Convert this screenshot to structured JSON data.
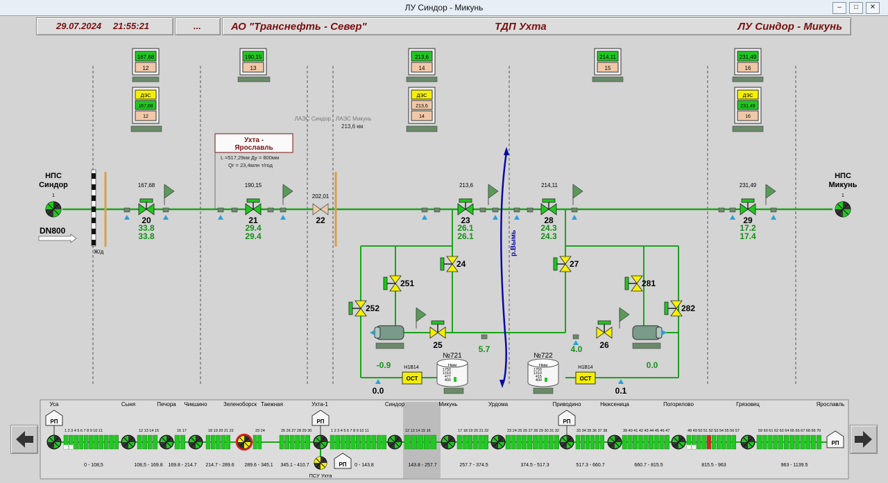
{
  "window": {
    "title": "ЛУ Синдор - Микунь",
    "min": "‒",
    "max": "□",
    "close": "✕"
  },
  "header": {
    "date": "29.07.2024",
    "time": "21:55:21",
    "dots": "...",
    "company": "АО \"Транснефть - Север\"",
    "department": "ТДП Ухта",
    "section": "ЛУ Синдор - Микунь"
  },
  "colors": {
    "pipe": "#1aa31a",
    "valve_green": "#1ec81e",
    "valve_yellow": "#f5f000",
    "header_text": "#7a1010",
    "label_green": "#159015",
    "river": "#0a0aa0",
    "barrier": "#d4a050"
  },
  "stations": {
    "start": {
      "name_line1": "НПС",
      "name_line2": "Синдор",
      "num": "1",
      "dn": "DN800",
      "rail": "Ж/д"
    },
    "end": {
      "name_line1": "НПС",
      "name_line2": "Микунь",
      "num": "1"
    }
  },
  "telemetry": [
    {
      "top": "167,68",
      "bottom": "12",
      "des_label": "ДЭС",
      "des_value": "167,68",
      "des_num": "12"
    },
    {
      "top": "190,15",
      "bottom": "13"
    },
    {
      "top": "213,6",
      "bottom": "14",
      "des_label": "ДЭС",
      "des_value": "213,6",
      "des_num": "14"
    },
    {
      "top": "214,11",
      "bottom": "15"
    },
    {
      "top": "231,49",
      "bottom": "16",
      "des_label": "ДЭС",
      "des_value": "231,49",
      "des_num": "16"
    }
  ],
  "valves": [
    {
      "km": "167,68",
      "num": "20",
      "p1": "33.8",
      "p2": "33.8"
    },
    {
      "km": "190,15",
      "num": "21",
      "p1": "29.4",
      "p2": "29.4"
    },
    {
      "km": "202,01",
      "num": "22"
    },
    {
      "km": "213,6",
      "num": "23",
      "p1": "26.1",
      "p2": "26.1"
    },
    {
      "km": "214,11",
      "num": "28",
      "p1": "24.3",
      "p2": "24.3"
    },
    {
      "km": "231,49",
      "num": "29",
      "p1": "17.2",
      "p2": "17.4"
    }
  ],
  "yellow_valves": {
    "v24": "24",
    "v27": "27",
    "v251": "251",
    "v252": "252",
    "v281": "281",
    "v282": "282",
    "v25": "25",
    "v26": "26"
  },
  "pressures": {
    "p57": "5.7",
    "p40": "4.0",
    "pm09": "-0.9",
    "p00a": "0.0",
    "p00b": "0.0",
    "p01": "0.1"
  },
  "info": {
    "pipeline_l1": "Ухта -",
    "pipeline_l2": "Ярославль",
    "length": "L =517,29км  Ду = 800мм",
    "flow": "Qг = 23,4млн т/год"
  },
  "boundary": {
    "left": "ЛАЭС Синдор",
    "right": "ЛАЭС Микунь",
    "km": "213,6 км"
  },
  "river": "р.Вымь",
  "tanks": [
    {
      "name": "№721",
      "hmm": "Нмм",
      "levels": [
        "1750",
        "1310",
        "477",
        "400"
      ],
      "tag": "Н1В14",
      "ost": "ОСТ"
    },
    {
      "name": "№722",
      "hmm": "Нмм",
      "levels": [
        "1750",
        "1310",
        "415",
        "400"
      ],
      "tag": "Н1В14",
      "ost": "ОСТ"
    }
  ],
  "overview": {
    "stations": [
      "Уса",
      "Сыня",
      "Печора",
      "Чикшино",
      "Зеленоборск",
      "Таежная",
      "Ухта-1",
      "Синдор",
      "Микунь",
      "Урдома",
      "Приводино",
      "Нюксеница",
      "Погорелово",
      "Грязовец",
      "Ярославль"
    ],
    "ranges": [
      "0 - 108,5",
      "108,5 - 169.8",
      "169.8 - 214.7",
      "214.7 - 289.6",
      "289.6 - 345.1",
      "345.1 - 410.7",
      "0 - 143.8",
      "143.8 - 257.7",
      "257.7 - 374.5",
      "374.5 - 517.3",
      "517.3 - 660.7",
      "660.7 - 815.5",
      "815.5 - 963",
      "963 - 1139.5"
    ],
    "groups": [
      "1 2 3 4 5 6 7 8 9 10 11",
      "12 13 14 15",
      "16 17",
      "18 19 20 21 22",
      "23 24",
      "25 26 27 28 29 30",
      "1 2 3 4 5 6 7 8 9 10 11",
      "12 13 14 15 16",
      "17 18 19 20 21 22",
      "23 24 25 26 27 28 29 30 31 32",
      "33 34 35 36 37 38",
      "39 40 41 42 43 44 45 46 47",
      "48 49 50 51 52 53 54 55 56 57",
      "59 60 61 62 63 64 65 66 67 68 69 70"
    ],
    "rp": "РП",
    "psu": "ПСУ Ухта"
  }
}
